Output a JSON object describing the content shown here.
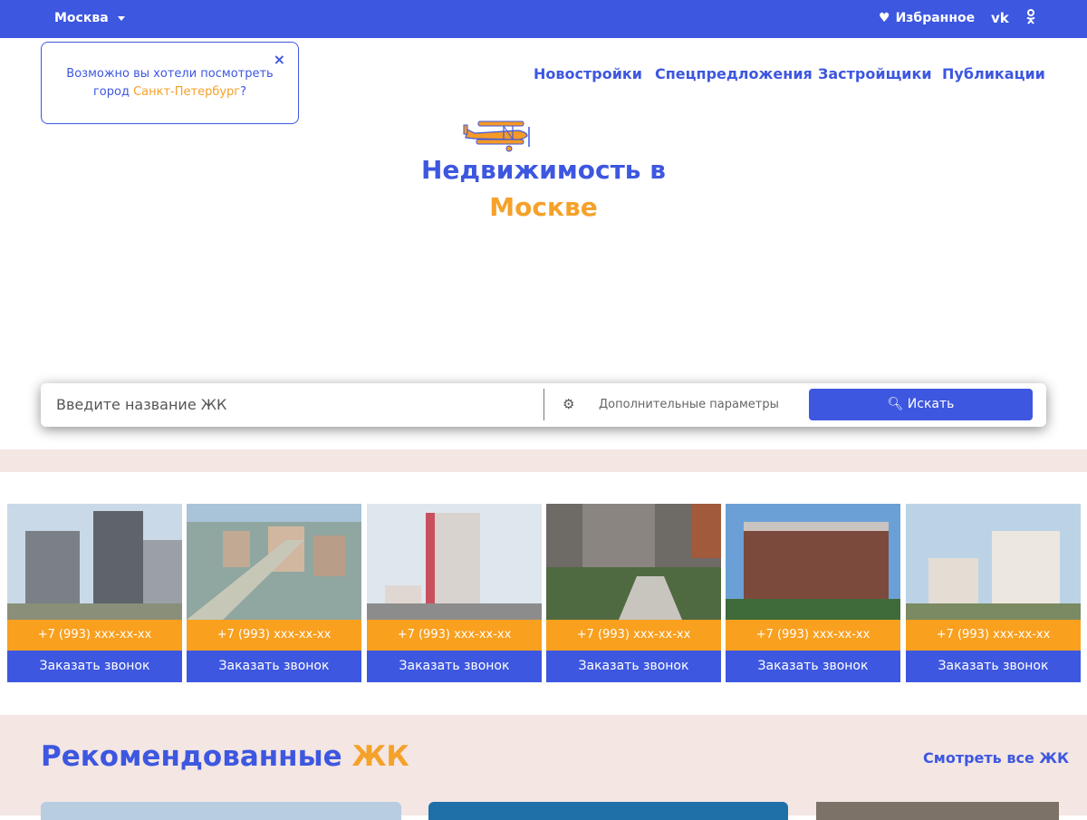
{
  "topbar": {
    "city": "Москва",
    "favorites": "Избранное",
    "vk": "vk-icon",
    "ok": "odnoklassniki-icon"
  },
  "popup": {
    "text_before": "Возможно вы хотели посмотреть",
    "text_city_prefix": "город ",
    "city_link": "Санкт-Петербург",
    "text_after": "?",
    "close": "×"
  },
  "nav": [
    {
      "label": "Новостройки"
    },
    {
      "label": "Спецпредложения"
    },
    {
      "label": "Застройщики"
    },
    {
      "label": "Публикации"
    }
  ],
  "hero": {
    "line1": "Недвижимость в",
    "line2": "Москве"
  },
  "search": {
    "placeholder": "Введите название ЖК",
    "params_label": "Дополнительные параметры",
    "button_label": "Искать"
  },
  "cards": [
    {
      "phone": "+7 (993) xxx-xx-xx",
      "call": "Заказать звонок"
    },
    {
      "phone": "+7 (993) xxx-xx-xx",
      "call": "Заказать звонок"
    },
    {
      "phone": "+7 (993) xxx-xx-xx",
      "call": "Заказать звонок"
    },
    {
      "phone": "+7 (993) xxx-xx-xx",
      "call": "Заказать звонок"
    },
    {
      "phone": "+7 (993) xxx-xx-xx",
      "call": "Заказать звонок"
    },
    {
      "phone": "+7 (993) xxx-xx-xx",
      "call": "Заказать звонок"
    }
  ],
  "recommended": {
    "title_main": "Рекомендованные",
    "title_accent": "ЖК",
    "see_all": "Смотреть все ЖК"
  },
  "colors": {
    "brand_blue": "#3d57e0",
    "accent_orange": "#f5a12a",
    "section_bg": "#f3e6e3"
  }
}
